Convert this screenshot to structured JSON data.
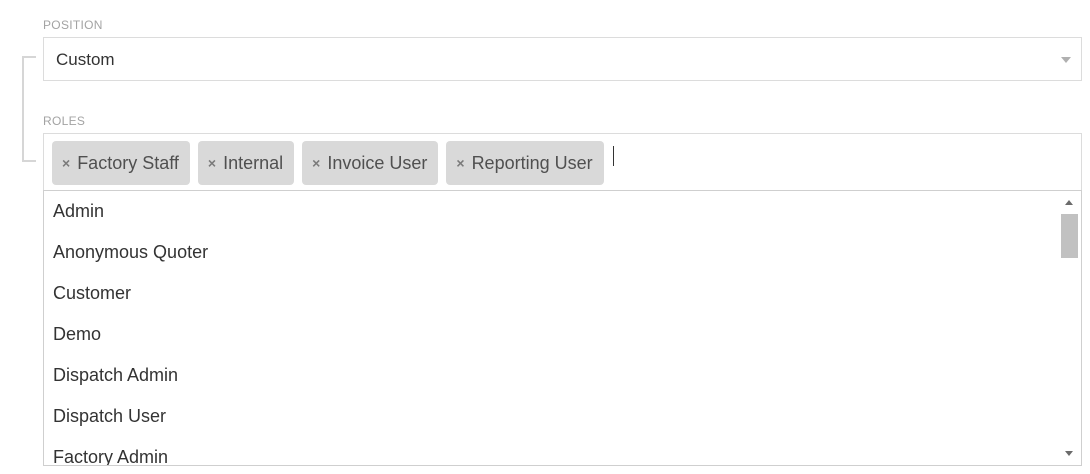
{
  "position": {
    "label": "POSITION",
    "selected": "Custom"
  },
  "roles": {
    "label": "ROLES",
    "selected_tags": [
      {
        "label": "Factory Staff"
      },
      {
        "label": "Internal"
      },
      {
        "label": "Invoice User"
      },
      {
        "label": "Reporting User"
      }
    ],
    "remove_glyph": "×",
    "options": [
      {
        "label": "Admin"
      },
      {
        "label": "Anonymous Quoter"
      },
      {
        "label": "Customer"
      },
      {
        "label": "Demo"
      },
      {
        "label": "Dispatch Admin"
      },
      {
        "label": "Dispatch User"
      },
      {
        "label": "Factory Admin"
      }
    ]
  },
  "colors": {
    "tag_background": "#d9d9d9",
    "label_text": "#a3a3a3",
    "border": "#dcdcdc"
  },
  "icons": {
    "select_caret": "chevron-down-icon",
    "tag_remove": "close-icon",
    "scroll_up": "scroll-up-icon",
    "scroll_down": "scroll-down-icon"
  }
}
